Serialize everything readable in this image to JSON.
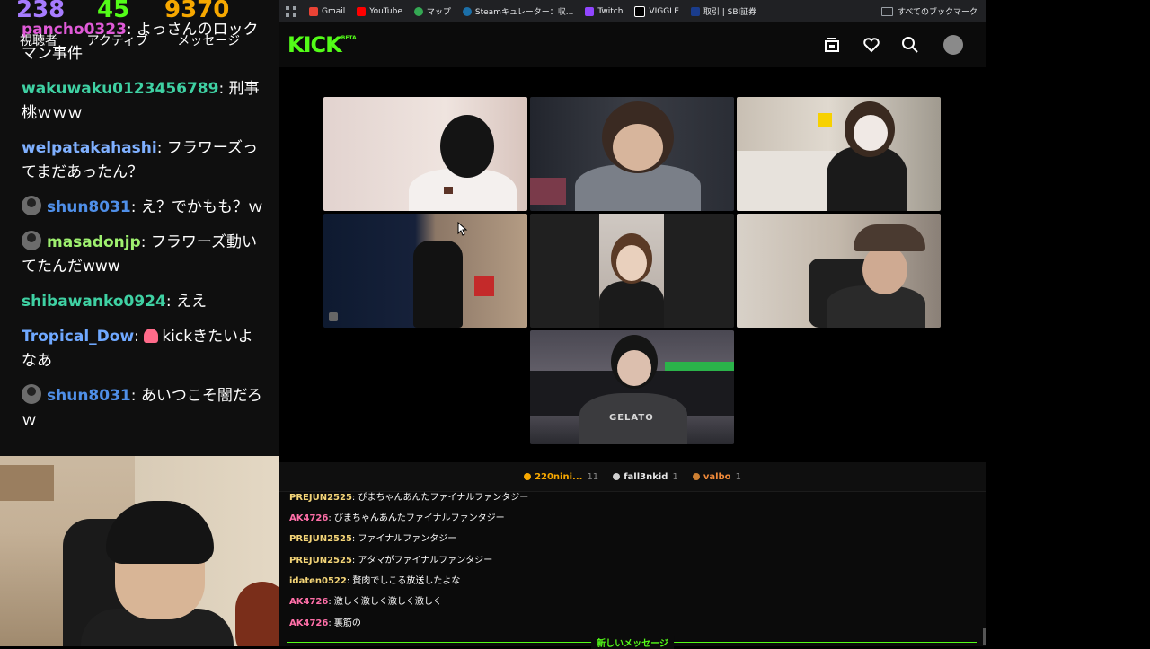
{
  "overlay": {
    "stats": [
      {
        "value": "238",
        "color": "#a77cff"
      },
      {
        "value": "45",
        "color": "#53fc18"
      },
      {
        "value": "9370",
        "color": "#f7a800"
      }
    ],
    "stat_labels": [
      "視聴者",
      "アクティブ",
      "メッセージ"
    ],
    "messages": [
      {
        "user": "pancho0323",
        "color": "#e05ad8",
        "text": ": よっさんのロックマン事件",
        "avatar": false
      },
      {
        "user": "wakuwaku0123456789",
        "color": "#3fd1a3",
        "text": ": 刑事桃ｗｗｗ",
        "avatar": false
      },
      {
        "user": "welpatakahashi",
        "color": "#7fb0ff",
        "text": ": フラワーズってまだあったん？",
        "avatar": false
      },
      {
        "user": "shun8031",
        "color": "#4f8fe8",
        "text": ": え？でかもも？ｗ",
        "avatar": true
      },
      {
        "user": "masadonjp",
        "color": "#9ef06f",
        "text": ": フラワーズ動いてたんだwww",
        "avatar": true
      },
      {
        "user": "shibawanko0924",
        "color": "#3fd1a3",
        "text": ": ええ",
        "avatar": false
      },
      {
        "user": "Tropical_Dow",
        "color": "#6fa8ff",
        "text": "kickきたいよなあ",
        "avatar": false,
        "emote": "mushroom-emote"
      },
      {
        "user": "shun8031",
        "color": "#4f8fe8",
        "text": ": あいつこそ闇だろｗ",
        "avatar": true
      }
    ]
  },
  "browser": {
    "bookmarks": [
      {
        "label": "Gmail",
        "icon": "gmail-icon",
        "color": "#ea4335"
      },
      {
        "label": "YouTube",
        "icon": "youtube-icon",
        "color": "#ff0000"
      },
      {
        "label": "マップ",
        "icon": "maps-icon",
        "color": "#34a853"
      },
      {
        "label": "Steamキュレーター：収...",
        "icon": "steam-icon",
        "color": "#1b6fa8"
      },
      {
        "label": "Twitch",
        "icon": "twitch-icon",
        "color": "#9146ff"
      },
      {
        "label": "VIGGLE",
        "icon": "viggle-icon",
        "color": "#ffffff"
      },
      {
        "label": "取引 | SBI証券",
        "icon": "sbi-icon",
        "color": "#1a3c8c"
      }
    ],
    "all_bookmarks": "すべてのブックマーク"
  },
  "kick": {
    "logo": "KICK",
    "logo_badge": "BETA",
    "accent": "#53fc18"
  },
  "chat": {
    "top_gifters": [
      {
        "name": "220nini...",
        "count": "11",
        "color": "#f7a800",
        "badge": "#f7a800"
      },
      {
        "name": "fall3nkid",
        "count": "1",
        "color": "#e8e8e8",
        "badge": "#cfcfcf"
      },
      {
        "name": "valbo",
        "count": "1",
        "color": "#f08a3a",
        "badge": "#cd7f32"
      }
    ],
    "messages": [
      {
        "user": "PREJUN2525",
        "color": "#f3d477",
        "text": ": ぴまちゃんあんたファイナルファンタジー"
      },
      {
        "user": "AK4726",
        "color": "#ff6fa8",
        "text": ": ぴまちゃんあんたファイナルファンタジー"
      },
      {
        "user": "PREJUN2525",
        "color": "#f3d477",
        "text": ": ファイナルファンタジー"
      },
      {
        "user": "PREJUN2525",
        "color": "#f3d477",
        "text": ": アタマがファイナルファンタジー"
      },
      {
        "user": "idaten0522",
        "color": "#f3d477",
        "text": ": 贅肉でしこる放送したよな"
      },
      {
        "user": "AK4726",
        "color": "#ff6fa8",
        "text": ": 激しく激しく激しく激しく"
      },
      {
        "user": "AK4726",
        "color": "#ff6fa8",
        "text": ": 裏筋の"
      }
    ],
    "new_messages_label": "新しいメッセージ"
  }
}
